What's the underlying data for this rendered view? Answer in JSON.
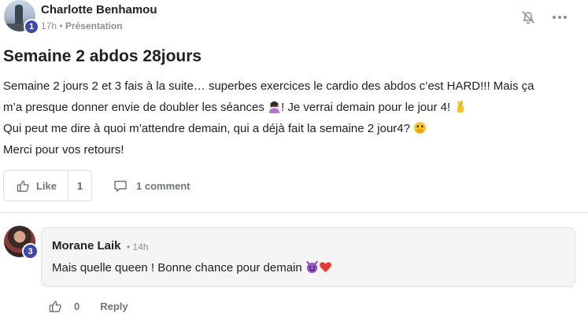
{
  "post": {
    "author": "Charlotte Benhamou",
    "level": "1",
    "time": "17h",
    "separator": "•",
    "category": "Présentation",
    "title": "Semaine 2 abdos 28jours",
    "body_line1": "Semaine 2 jours 2 et 3 fais à la suite… superbes exercices le cardio des abdos c’est HARD!!! Mais ça",
    "body_line2a": "m’a presque donner envie de doubler les séances ",
    "body_line2b": "! Je verrai demain pour le jour 4! ",
    "body_line3": "Qui peut me dire à quoi m’attendre demain, qui a déjà fait la semaine 2 jour4? ",
    "body_line4": "Merci pour vos retours!",
    "emojis": [
      "person-tipping-hand-emoji",
      "crossed-fingers-emoji",
      "face-with-open-eyes-hand-over-mouth-emoji"
    ]
  },
  "actions": {
    "like_label": "Like",
    "like_count": "1",
    "comment_label": "1 comment"
  },
  "comment": {
    "author": "Morane Laik",
    "level": "3",
    "time": "14h",
    "separator": "•",
    "text": "Mais quelle queen ! Bonne chance pour demain ",
    "emojis": [
      "smiling-imp-emoji",
      "red-heart-emoji"
    ],
    "like_count": "0",
    "reply_label": "Reply"
  },
  "icons": [
    "bell-off-icon",
    "more-horizontal-icon",
    "thumbs-up-icon",
    "comment-bubble-icon"
  ],
  "colors": {
    "badge": "#3b4aa8",
    "text": "#202124",
    "muted": "#909090",
    "border": "#dadce0",
    "comment_bg": "#f5f5f5"
  }
}
